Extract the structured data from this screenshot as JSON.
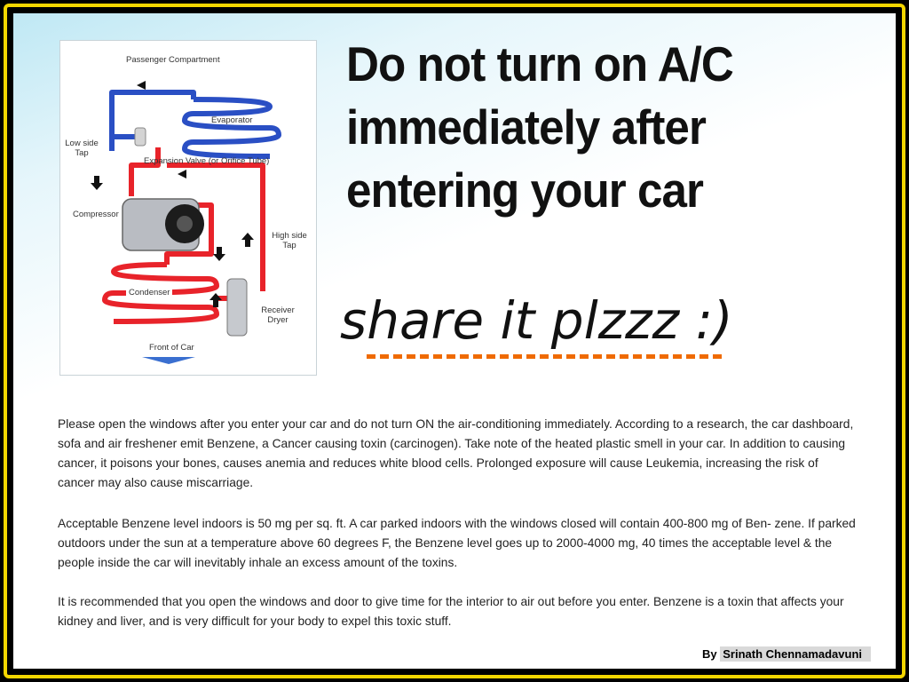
{
  "diagram": {
    "labels": {
      "passenger_compartment": "Passenger Compartment",
      "evaporator": "Evaporator",
      "low_side_tap": "Low side Tap",
      "expansion_valve": "Expansion Valve (or Orifice Tube)",
      "compressor": "Compressor",
      "high_side_tap": "High side Tap",
      "condenser": "Condenser",
      "receiver_dryer": "Receiver Dryer",
      "front_of_car": "Front of Car"
    },
    "colors": {
      "low_pressure": "#2a4fc4",
      "high_pressure": "#e8232a"
    }
  },
  "headline": {
    "line1": "Do not turn on A/C",
    "line2": "immediately after",
    "line3": "entering your car"
  },
  "share_text": "share it plzzz :)",
  "accent_color": "#ef6a00",
  "paragraphs": [
    "Please open the windows after you enter your car and do not turn ON the air-conditioning immediately. According to a research, the car dashboard,  sofa and  air freshener emit Benzene, a Cancer causing toxin (carcinogen). Take note  of the heated plastic smell in your car. In addition to causing cancer, it poisons  your bones, causes anemia and reduces white blood cells. Prolonged exposure  will cause Leukemia, increasing the risk of cancer may also cause miscarriage.",
    "Acceptable Benzene level indoors is 50 mg per sq. ft. A car parked indoors with  the windows closed will contain 400-800 mg of Ben- zene. If parked outdoors  under the sun at a temperature above 60 degrees F, the Benzene level goes up  to 2000-4000 mg, 40 times the acceptable level & the people inside the car will  inevitably inhale an excess amount of the toxins.",
    "It is recommended that you open the windows and door to give time for  the interior to air out before you enter. Benzene is a toxin that affects your kidney and liver, and is very difficult for your body to expel this toxic stuff."
  ],
  "credit": {
    "by": "By",
    "name": "Srinath Chennamadavuni"
  }
}
